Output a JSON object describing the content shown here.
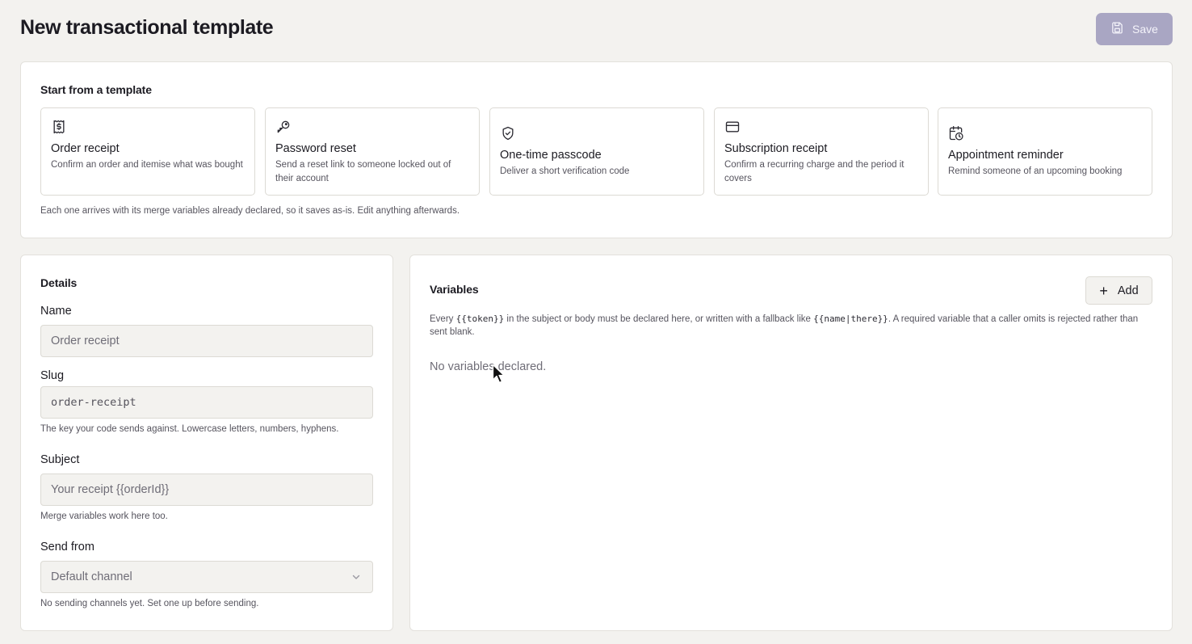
{
  "header": {
    "title": "New transactional template",
    "save_label": "Save",
    "save_icon": "save-icon"
  },
  "templates": {
    "heading": "Start from a template",
    "items": [
      {
        "icon": "receipt-icon",
        "title": "Order receipt",
        "desc": "Confirm an order and itemise what was bought"
      },
      {
        "icon": "key-icon",
        "title": "Password reset",
        "desc": "Send a reset link to someone locked out of their account"
      },
      {
        "icon": "shield-check-icon",
        "title": "One-time passcode",
        "desc": "Deliver a short verification code"
      },
      {
        "icon": "credit-card-icon",
        "title": "Subscription receipt",
        "desc": "Confirm a recurring charge and the period it covers"
      },
      {
        "icon": "calendar-clock-icon",
        "title": "Appointment reminder",
        "desc": "Remind someone of an upcoming booking"
      }
    ],
    "note": "Each one arrives with its merge variables already declared, so it saves as-is. Edit anything afterwards."
  },
  "details": {
    "heading": "Details",
    "name_label": "Name",
    "name_placeholder": "Order receipt",
    "slug_label": "Slug",
    "slug_placeholder": "order-receipt",
    "slug_hint": "The key your code sends against. Lowercase letters, numbers, hyphens.",
    "subject_label": "Subject",
    "subject_placeholder": "Your receipt {{orderId}}",
    "subject_hint": "Merge variables work here too.",
    "send_from_label": "Send from",
    "send_from_value": "Default channel",
    "send_from_hint": "No sending channels yet. Set one up before sending."
  },
  "variables": {
    "heading": "Variables",
    "add_label": "Add",
    "desc_before": "Every ",
    "desc_code1": "{{token}}",
    "desc_middle": " in the subject or body must be declared here, or written with a fallback like ",
    "desc_code2": "{{name|there}}",
    "desc_after": ". A required variable that a caller omits is rejected rather than sent blank.",
    "empty": "No variables declared."
  },
  "colors": {
    "background": "#f3f2ef",
    "save_disabled": "#a9a6c3",
    "text": "#1c1b22",
    "muted_text": "#56545e"
  }
}
